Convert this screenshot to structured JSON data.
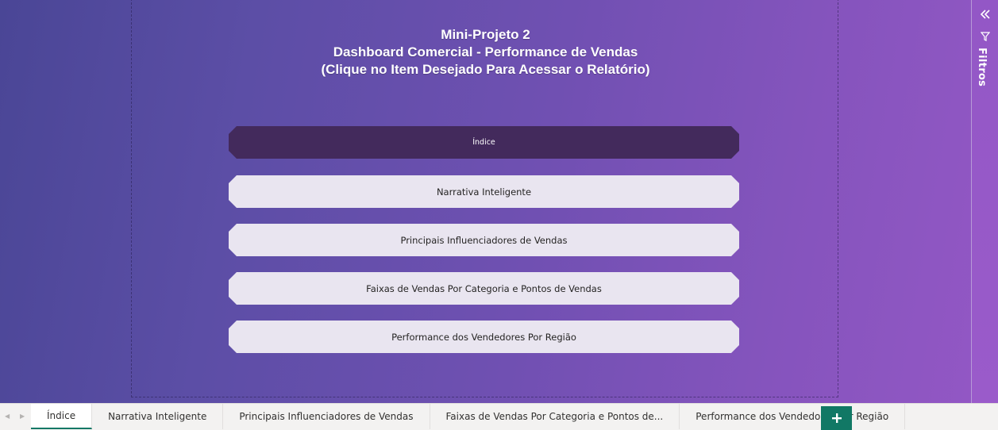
{
  "report": {
    "title_line1": "Mini-Projeto 2",
    "title_line2": "Dashboard Comercial - Performance de Vendas",
    "title_line3": "(Clique no Item Desejado Para Acessar o Relatório)"
  },
  "nav_buttons": [
    {
      "label": "Índice",
      "active": true
    },
    {
      "label": "Narrativa Inteligente",
      "active": false
    },
    {
      "label": "Principais Influenciadores de Vendas",
      "active": false
    },
    {
      "label": "Faixas de Vendas Por Categoria e Pontos de Vendas",
      "active": false
    },
    {
      "label": "Performance dos Vendedores Por Região",
      "active": false
    }
  ],
  "filters_pane": {
    "label": "Filtros",
    "collapse_icon": "double-chevron-left-icon",
    "filter_icon": "funnel-icon"
  },
  "page_tabs": [
    {
      "label": "Índice",
      "active": true
    },
    {
      "label": "Narrativa Inteligente",
      "active": false
    },
    {
      "label": "Principais Influenciadores de Vendas",
      "active": false
    },
    {
      "label": "Faixas de Vendas Por Categoria e Pontos de...",
      "active": false
    },
    {
      "label": "Performance dos Vendedores Por Região",
      "active": false
    }
  ],
  "add_page_button": {
    "label": "+",
    "icon": "plus-icon"
  },
  "colors": {
    "active_button": "#432a5c",
    "inactive_button": "#e9e5f0",
    "tab_accent": "#117865"
  }
}
